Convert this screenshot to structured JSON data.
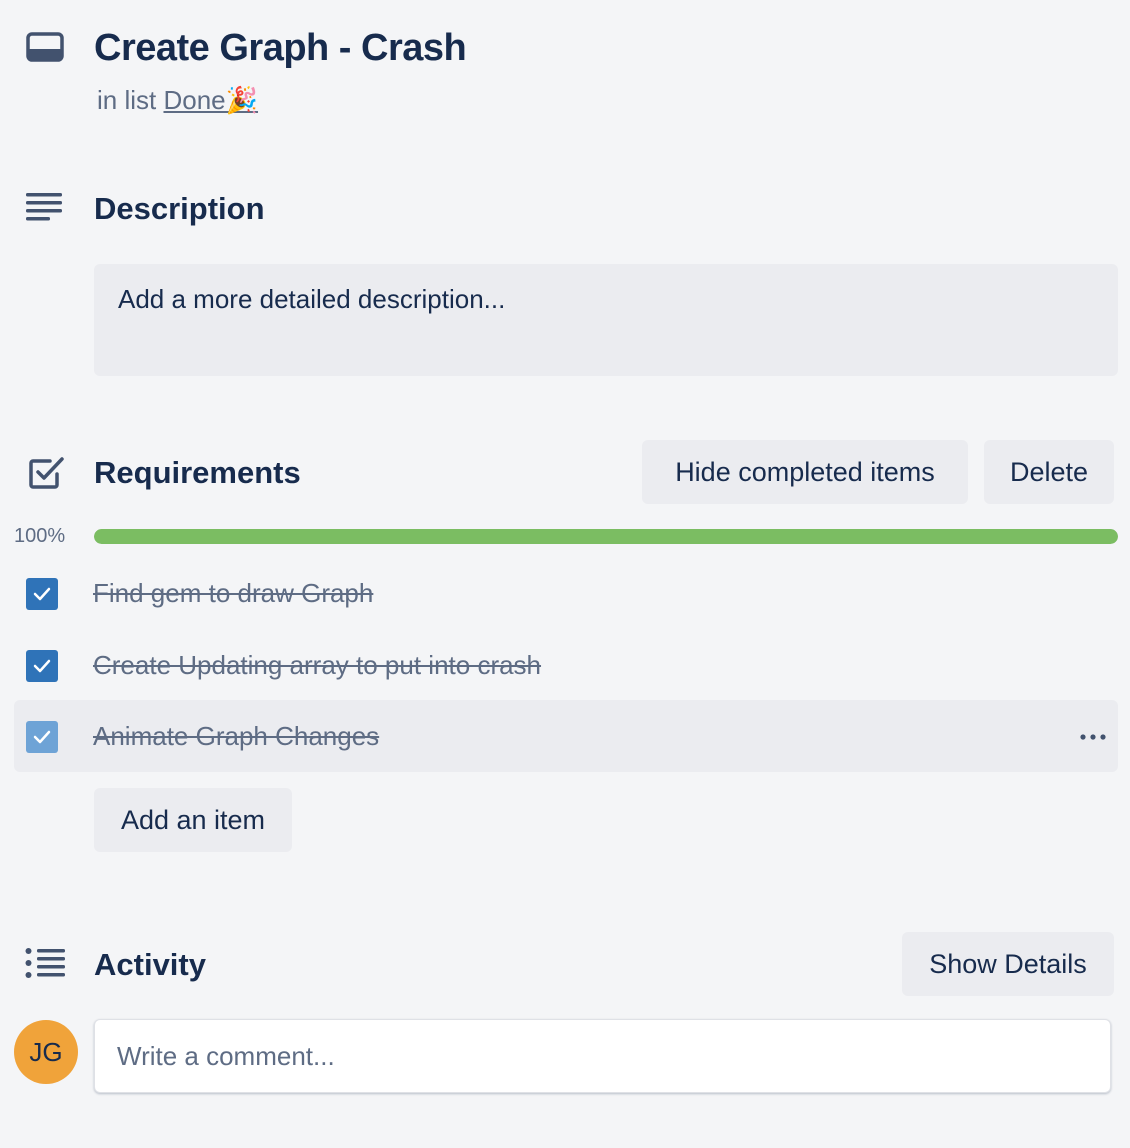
{
  "card": {
    "title": "Create Graph - Crash",
    "in_list_prefix": "in list",
    "list_name": "Done🎉"
  },
  "description": {
    "heading": "Description",
    "placeholder": "Add a more detailed description..."
  },
  "checklist": {
    "heading": "Requirements",
    "hide_completed_label": "Hide completed items",
    "delete_label": "Delete",
    "progress_percent": 100,
    "progress_label": "100%",
    "items": [
      {
        "text": "Find gem to draw Graph",
        "checked": true
      },
      {
        "text": "Create Updating array to put into crash",
        "checked": true
      },
      {
        "text": "Animate Graph Changes",
        "checked": true
      }
    ],
    "add_item_label": "Add an item"
  },
  "activity": {
    "heading": "Activity",
    "show_details_label": "Show Details",
    "avatar_initials": "JG",
    "comment_placeholder": "Write a comment..."
  },
  "colors": {
    "background": "#f4f5f7",
    "progress_fill": "#7bbd62",
    "checkbox": "#2f73b8",
    "avatar": "#f0a33a"
  },
  "icons": [
    "card-icon",
    "description-icon",
    "checklist-icon",
    "activity-icon",
    "checkmark-icon",
    "more-icon"
  ]
}
